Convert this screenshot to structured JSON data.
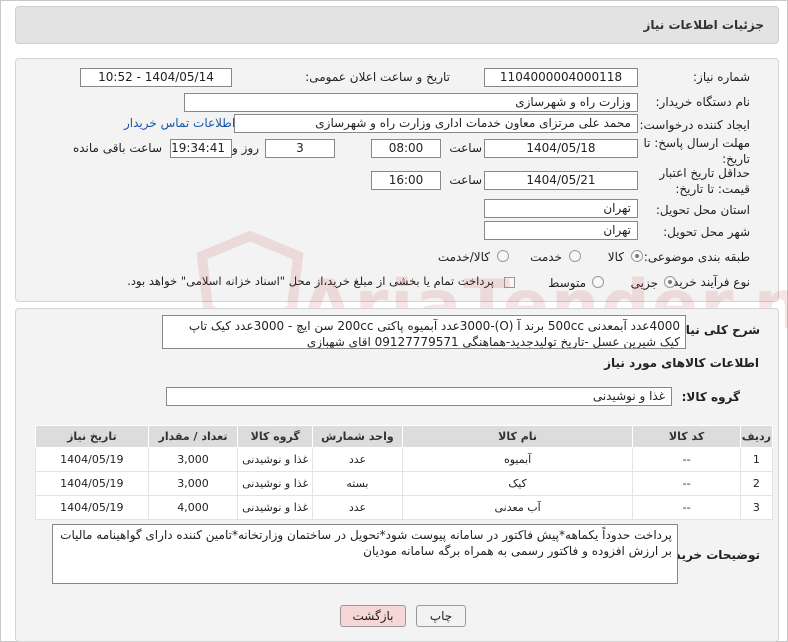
{
  "header": {
    "title": "جزئیات اطلاعات نیاز"
  },
  "form": {
    "need_number_label": "شماره نیاز:",
    "need_number": "1104000004000118",
    "announce_label": "تاریخ و ساعت اعلان عمومی:",
    "announce_value": "1404/05/14 - 10:52",
    "buyer_org_label": "نام دستگاه خریدار:",
    "buyer_org": "وزارت راه و شهرسازی",
    "creator_label": "ایجاد کننده درخواست:",
    "creator": "محمد علی  مرتزای معاون خدمات اداری وزارت راه و شهرسازی",
    "contact_link": "اطلاعات تماس خریدار",
    "send_deadline_label": "مهلت ارسال پاسخ: تا تاریخ:",
    "send_date": "1404/05/18",
    "time_label": "ساعت",
    "send_time": "08:00",
    "days_value": "3",
    "days_label": "روز و",
    "remaining_time": "19:34:41",
    "remaining_label": "ساعت باقی مانده",
    "price_validity_label": "حداقل تاریخ اعتبار قیمت: تا تاریخ:",
    "validity_date": "1404/05/21",
    "validity_time": "16:00",
    "province_label": "استان محل تحویل:",
    "province": "تهران",
    "city_label": "شهر محل تحویل:",
    "city": "تهران",
    "category_label": "طبقه بندی موضوعی:",
    "category_options": [
      "کالا",
      "خدمت",
      "کالا/خدمت"
    ],
    "process_label": "نوع فرآیند خرید :",
    "process_options": [
      "جزیی",
      "متوسط"
    ],
    "payment_note": "پرداخت تمام یا بخشی از مبلغ خرید،از محل \"اسناد خزانه اسلامی\" خواهد بود."
  },
  "summary": {
    "label": "شرح کلی نیاز:",
    "text": "4000عدد آبمعدنی 500cc برند آ (O)-3000عدد آبمیوه پاکتی 200cc سن ایچ - 3000عدد کیک تاپ کیک شیرین عسل -تاریخ تولیدجدید-هماهنگی 09127779571 اقای شهبازی"
  },
  "goods": {
    "section_title": "اطلاعات کالاهای مورد نیاز",
    "group_label": "گروه کالا:",
    "group_value": "غذا و نوشیدنی",
    "columns": [
      "ردیف",
      "کد کالا",
      "نام کالا",
      "واحد شمارش",
      "گروه کالا",
      "تعداد / مقدار",
      "تاریخ نیاز"
    ],
    "rows": [
      {
        "idx": "1",
        "code": "--",
        "name": "آبمیوه",
        "unit": "عدد",
        "group": "غذا و نوشیدنی",
        "qty": "3,000",
        "date": "1404/05/19"
      },
      {
        "idx": "2",
        "code": "--",
        "name": "کیک",
        "unit": "بسته",
        "group": "غذا و نوشیدنی",
        "qty": "3,000",
        "date": "1404/05/19"
      },
      {
        "idx": "3",
        "code": "--",
        "name": "آب معدنی",
        "unit": "عدد",
        "group": "غذا و نوشیدنی",
        "qty": "4,000",
        "date": "1404/05/19"
      }
    ]
  },
  "buyer_notes": {
    "label": "توضیحات خریدار:",
    "text": "پرداخت حدوداً یکماهه*پیش فاکتور در سامانه پیوست شود*تحویل در ساختمان وزارتخانه*تامین کننده دارای گواهینامه مالیات بر ارزش افزوده و فاکتور رسمی به همراه برگه  سامانه مودیان"
  },
  "buttons": {
    "print": "چاپ",
    "back": "بازگشت"
  },
  "colors": {
    "link": "#1a55a5",
    "back_button_bg": "#f7d6d6",
    "watermark": "#c03030"
  },
  "watermark_text": "AriaTender.neT"
}
